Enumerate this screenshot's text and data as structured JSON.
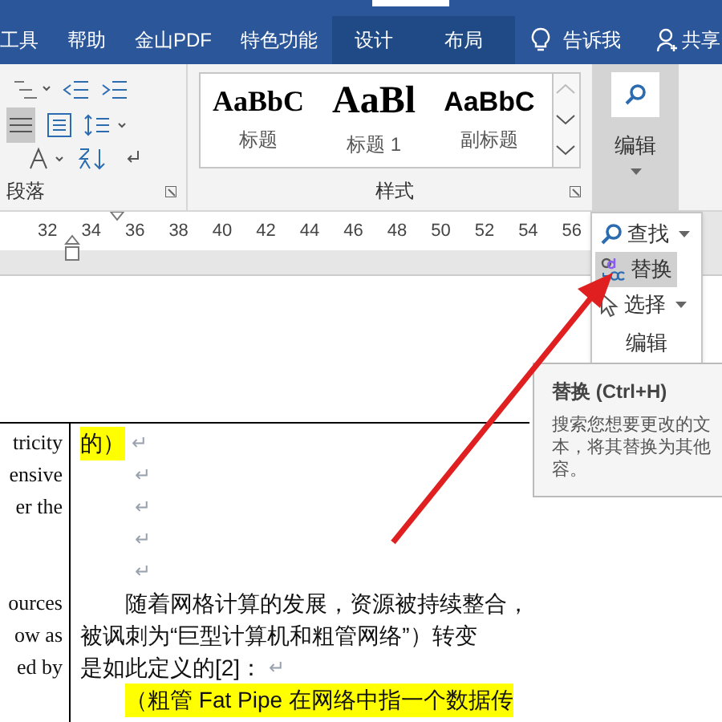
{
  "menu_tabs": [
    {
      "label": "工具",
      "selected": false
    },
    {
      "label": "帮助",
      "selected": false
    },
    {
      "label": "金山PDF",
      "selected": false
    },
    {
      "label": "特色功能",
      "selected": false
    },
    {
      "label": "设计",
      "selected": true
    },
    {
      "label": "布局",
      "selected": true
    }
  ],
  "tell_me": "告诉我",
  "share": "共享",
  "paragraph_group": {
    "label": "段落"
  },
  "styles_group": {
    "label": "样式",
    "styles": [
      {
        "sample": "AaBbC",
        "name": "标题",
        "kind": "serif"
      },
      {
        "sample": "AaBl",
        "name": "标题 1",
        "kind": "large"
      },
      {
        "sample": "AaBbC",
        "name": "副标题",
        "kind": "sans"
      }
    ]
  },
  "editing_group": {
    "label": "编辑"
  },
  "ruler": [
    "32",
    "34",
    "36",
    "38",
    "40",
    "42",
    "44",
    "46",
    "48",
    "50",
    "52",
    "54",
    "56"
  ],
  "edit_menu": [
    {
      "label": "查找",
      "has_caret": true,
      "selected": false,
      "kind": "find"
    },
    {
      "label": "替换",
      "has_caret": false,
      "selected": true,
      "kind": "replace"
    },
    {
      "label": "选择",
      "has_caret": true,
      "selected": false,
      "kind": "select"
    }
  ],
  "edit_menu_label": "编辑",
  "tooltip": {
    "title": "替换 (Ctrl+H)",
    "lines": [
      "搜索您想要更改的文",
      "本，将其替换为其他",
      "容。"
    ]
  },
  "left_column": [
    [
      "tricity",
      "ensive",
      "er the"
    ],
    [
      "ources",
      "ow as",
      "ed by"
    ]
  ],
  "paragraphs": [
    {
      "text": "的）",
      "mark": "↵",
      "kind": "highlight"
    },
    {
      "mark": "↵",
      "kind": "empty"
    },
    {
      "mark": "↵",
      "kind": "empty"
    },
    {
      "mark": "↵",
      "kind": "empty"
    },
    {
      "mark": "↵",
      "kind": "empty"
    },
    {
      "text": "随着网格计算的发展，资源被持续整合，",
      "kind": "indent"
    },
    {
      "text": "被讽刺为“巨型计算机和粗管网络”）转变",
      "kind": "plain"
    },
    {
      "text": "是如此定义的[2]：",
      "mark": "↵",
      "kind": "plain"
    },
    {
      "text": "（粗管 Fat Pipe 在网络中指一个数据传",
      "kind": "indent_highlight"
    }
  ]
}
